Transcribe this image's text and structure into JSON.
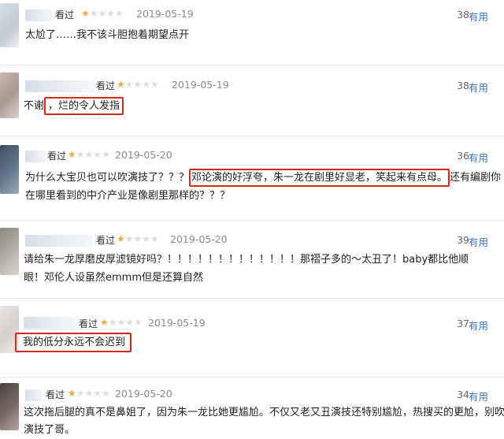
{
  "reviews": [
    {
      "seen": "看过",
      "date": "2019-05-19",
      "count": "38",
      "useful": "有用",
      "lines": [
        "太尬了……我不该斗胆抱着期望点开"
      ]
    },
    {
      "seen": "看过",
      "date": "2019-05-19",
      "count": "38",
      "useful": "有用",
      "pre": "不谢",
      "hl": "，烂的令人发指"
    },
    {
      "seen": "看过",
      "date": "2019-05-20",
      "count": "36",
      "useful": "有用",
      "pre": "为什么大宝贝也可以吹演技了？？？",
      "hl": "邓论演的好浮夸，朱一龙在剧里好显老，笑起来有点母。",
      "post": "还有编剧你",
      "line2": "在哪里看到的中介产业是像剧里那样的？？？"
    },
    {
      "seen": "看过",
      "date": "2019-05-20",
      "count": "39",
      "useful": "有用",
      "lines": [
        "请给朱一龙厚磨皮厚滤镜好吗？！！！！！！！！！！！！！那褶子多的～太丑了！baby都比他顺",
        "眼！邓伦人设虽然emmm但是还算自然"
      ]
    },
    {
      "seen": "看过",
      "date": "2019-05-19",
      "count": "37",
      "useful": "有用",
      "hl": "我的低分永远不会迟到"
    },
    {
      "seen": "看过",
      "date": "2019-05-20",
      "count": "34",
      "useful": "有用",
      "lines": [
        "这次拖后腿的真不是鼻姐了，因为朱一龙比她更尴尬。不仅又老又丑演技还特别尴尬，热搜买的更尬，别吹",
        "演技了哥。"
      ]
    }
  ]
}
